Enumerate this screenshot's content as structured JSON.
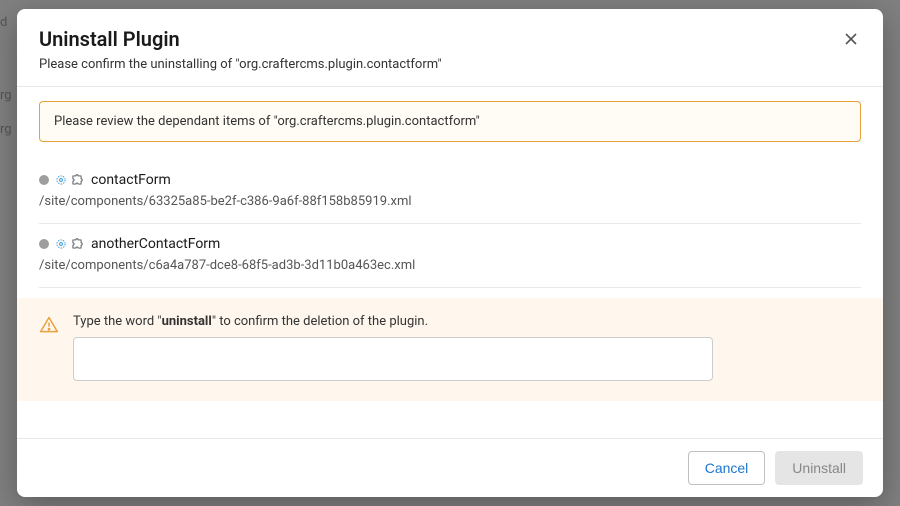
{
  "dialog": {
    "title": "Uninstall Plugin",
    "subtitle": "Please confirm the uninstalling of \"org.craftercms.plugin.contactform\""
  },
  "review_banner": "Please review the dependant items of \"org.craftercms.plugin.contactform\"",
  "dependants": [
    {
      "name": "contactForm",
      "path": "/site/components/63325a85-be2f-c386-9a6f-88f158b85919.xml"
    },
    {
      "name": "anotherContactForm",
      "path": "/site/components/c6a4a787-dce8-68f5-ad3b-3d11b0a463ec.xml"
    }
  ],
  "confirm": {
    "text_prefix": "Type the word \"",
    "text_bold": "uninstall",
    "text_suffix": "\" to confirm the deletion of the plugin.",
    "input_value": ""
  },
  "footer": {
    "cancel": "Cancel",
    "uninstall": "Uninstall"
  }
}
